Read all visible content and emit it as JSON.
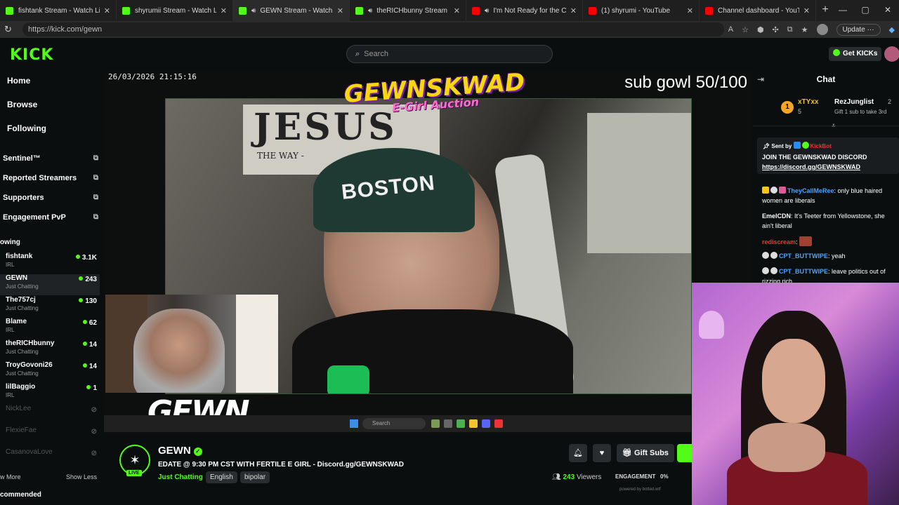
{
  "browser": {
    "tabs": [
      {
        "title": "fishtank Stream - Watch Live on K",
        "color": "#53fc18",
        "speaker": false,
        "active": false
      },
      {
        "title": "shyrumii Stream - Watch Live on K",
        "color": "#53fc18",
        "speaker": false,
        "active": false
      },
      {
        "title": "GEWN Stream - Watch Live on",
        "color": "#53fc18",
        "speaker": true,
        "active": true
      },
      {
        "title": "theRICHbunny Stream - Watc",
        "color": "#53fc18",
        "speaker": true,
        "active": false
      },
      {
        "title": "I'm Not Ready for the Change",
        "color": "#ff0000",
        "speaker": true,
        "active": false
      },
      {
        "title": "(1) shyrumi - YouTube",
        "color": "#ff0000",
        "speaker": false,
        "active": false
      },
      {
        "title": "Channel dashboard - YouTube Stu",
        "color": "#ff0000",
        "speaker": false,
        "active": false
      }
    ],
    "url": "https://kick.com/gewn",
    "update_label": "Update"
  },
  "header": {
    "logo": "KICK",
    "search_placeholder": "Search",
    "get_kicks": "Get KICKs"
  },
  "sidebar": {
    "nav": [
      "Home",
      "Browse",
      "Following"
    ],
    "extensions": [
      "Sentinel™",
      "Reported Streamers",
      "Supporters",
      "Engagement PvP"
    ],
    "following_label": "owing",
    "channels": [
      {
        "name": "fishtank",
        "category": "IRL",
        "viewers": "3.1K",
        "live": true
      },
      {
        "name": "GEWN",
        "category": "Just Chatting",
        "viewers": "243",
        "live": true
      },
      {
        "name": "The757cj",
        "category": "Just Chatting",
        "viewers": "130",
        "live": true
      },
      {
        "name": "Blame",
        "category": "IRL",
        "viewers": "62",
        "live": true
      },
      {
        "name": "theRICHbunny",
        "category": "Just Chatting",
        "viewers": "14",
        "live": true
      },
      {
        "name": "TroyGovoni26",
        "category": "Just Chatting",
        "viewers": "14",
        "live": true
      },
      {
        "name": "lilBaggio",
        "category": "IRL",
        "viewers": "1",
        "live": true
      },
      {
        "name": "NickLee",
        "category": "",
        "viewers": "",
        "live": false
      },
      {
        "name": "FlexieFae",
        "category": "",
        "viewers": "",
        "live": false
      },
      {
        "name": "CasanovaLove",
        "category": "",
        "viewers": "",
        "live": false
      }
    ],
    "show_more": "w More",
    "show_less": "Show Less",
    "recommended": "commended"
  },
  "stream": {
    "datetime": "26/03/2026 21:15:16",
    "sub_goal": "sub gowl 50/100",
    "brand_big": "GEWNSKWAD",
    "brand_small": "E-Girl Auction",
    "poster_big": "JESUS",
    "poster_small": "THE WAY -",
    "hat_text": "BOSTON",
    "gewn_logo": "GEWN",
    "taskbar_search": "Search"
  },
  "info": {
    "channel": "GEWN",
    "live_badge": "LIVE",
    "title": "EDATE @ 9:30 PM CST WITH FERTILE E GIRL - Discord.gg/GEWNSKWAD",
    "category": "Just Chatting",
    "tags": [
      "English",
      "bipolar"
    ],
    "viewers": "243",
    "viewers_label": "Viewers",
    "gift_subs": "Gift Subs",
    "engagement_label": "ENGAGEMENT",
    "engagement_value": "0%",
    "powered": "powered by botted.wtf"
  },
  "chat": {
    "title": "Chat",
    "gifter1": {
      "name": "xTYxx",
      "count": "5"
    },
    "gifter2": {
      "name": "RezJunglist",
      "count": "2",
      "sub": "Gift 1 sub to take 3rd"
    },
    "pinned": {
      "sent_by": "Sent by",
      "bot": "KickBot",
      "line1": "JOIN THE GEWNSKWAD DISCORD",
      "line2": "https://discord.gg/GEWNSKWAD"
    },
    "messages": [
      {
        "user": "TheyCallMeRee",
        "text": "only blue haired women are liberals",
        "color": "#4aa3ff"
      },
      {
        "user": "EmelCDN",
        "text": "It's Teeter from Yellowstone, she ain't liberal",
        "color": "#ffffff"
      },
      {
        "user": "rediscream",
        "text": "",
        "color": "#e03a3a"
      },
      {
        "user": "CPT_BUTTWIPE",
        "text": "yeah",
        "color": "#4aa3ff"
      },
      {
        "user": "CPT_BUTTWIPE",
        "text": "leave politics out of rizzing rich",
        "color": "#4aa3ff"
      }
    ]
  }
}
